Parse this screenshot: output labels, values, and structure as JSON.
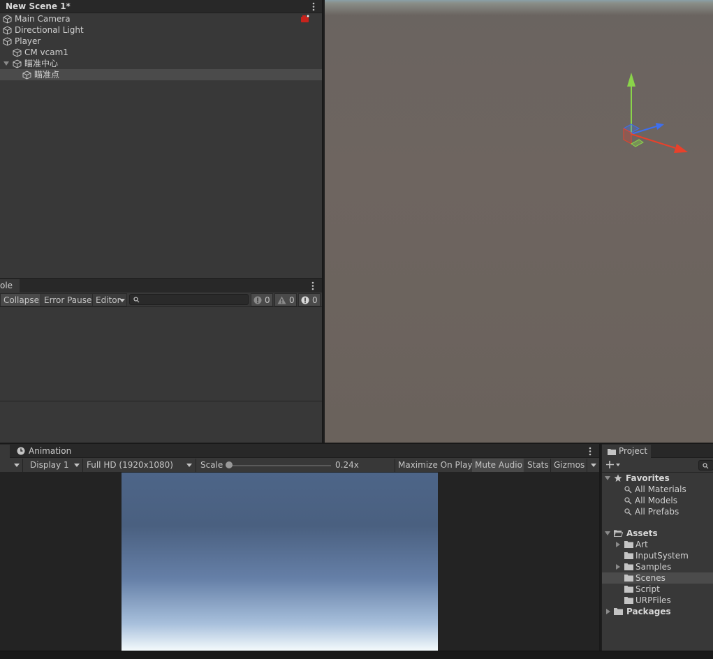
{
  "hierarchy": {
    "scene_title": "New Scene 1*",
    "items": [
      {
        "label": "Main Camera"
      },
      {
        "label": "Directional Light"
      },
      {
        "label": "Player"
      },
      {
        "label": "CM vcam1"
      },
      {
        "label": "瞄准中心"
      },
      {
        "label": "瞄准点"
      }
    ]
  },
  "console": {
    "tab_label": "ole",
    "buttons": {
      "collapse": "Collapse",
      "error_pause": "Error Pause",
      "editor": "Editor"
    },
    "counts": {
      "info": "0",
      "warnings": "0",
      "errors": "0"
    }
  },
  "game": {
    "tab_label": "Animation",
    "display": "Display 1",
    "resolution": "Full HD (1920x1080)",
    "scale_label": "Scale",
    "scale_value": "0.24x",
    "maximize_on_play": "Maximize On Play",
    "mute_audio": "Mute Audio",
    "stats": "Stats",
    "gizmos": "Gizmos"
  },
  "project": {
    "tab_label": "Project",
    "favorites_label": "Favorites",
    "favorites": [
      {
        "label": "All Materials"
      },
      {
        "label": "All Models"
      },
      {
        "label": "All Prefabs"
      }
    ],
    "assets_label": "Assets",
    "assets": [
      {
        "label": "Art"
      },
      {
        "label": "InputSystem"
      },
      {
        "label": "Samples"
      },
      {
        "label": "Scenes"
      },
      {
        "label": "Script"
      },
      {
        "label": "URPFiles"
      }
    ],
    "packages_label": "Packages"
  },
  "colors": {
    "panel": "#383838",
    "header": "#282828",
    "selection": "#4b4b4b",
    "axis_x": "#e8412b",
    "axis_y": "#8ad44a",
    "axis_z": "#3d6ff0"
  }
}
